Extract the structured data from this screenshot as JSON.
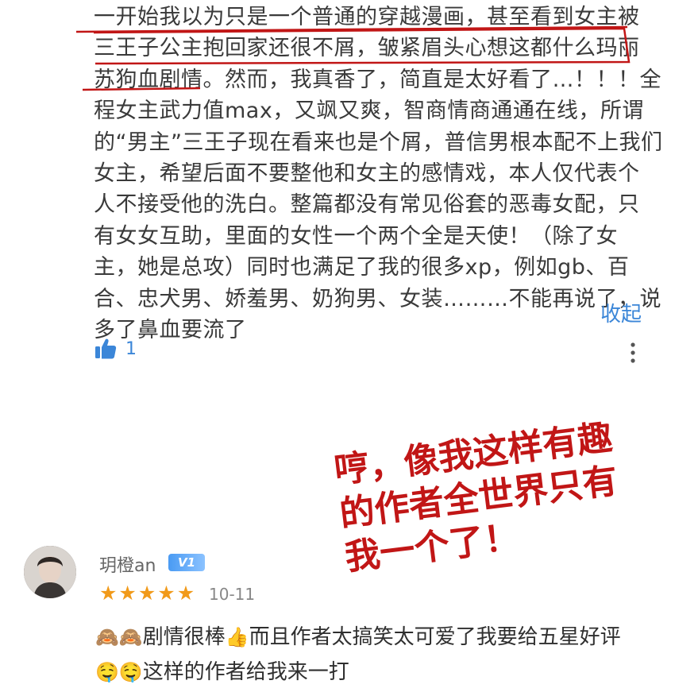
{
  "review": {
    "lines": [
      "一开始我以为只是一个普通的穿越漫画，甚至看到女主被",
      "三王子公主抱回家还很不屑，皱紧眉头心想这都什么玛丽",
      "苏狗血剧情。然而，我真香了，简直是太好看了…！！！全",
      "程女主武力值max，又飒又爽，智商情商通通在线，所谓",
      "的“男主”三王子现在看来也是个屑，普信男根本配不上我们",
      "女主，希望后面不要整他和女主的感情戏，本人仅代表个",
      "人不接受他的洗白。整篇都没有常见俗套的恶毒女配，只",
      "有女女互助，里面的女性一个两个全是天使！（除了女",
      "主，她是总攻）同时也满足了我的很多xp，例如gb、百",
      "合、忠犬男、娇羞男、奶狗男、女装………不能再说了，说",
      "多了鼻血要流了"
    ],
    "collapse_label": "收起",
    "like_count": "1",
    "like_icon": "thumbs-up-icon",
    "more_icon": "more-vertical-icon"
  },
  "annotation": {
    "lines": [
      "哼，像我这样有趣",
      "的作者全世界只有",
      "我一个了！"
    ],
    "color": "#c11616"
  },
  "comment": {
    "username": "玥橙an",
    "badge": "V1",
    "rating": 5,
    "date": "10-11",
    "line1_a": "剧情很棒",
    "line1_b": "而且作者太搞笑太可爱了我要给五星好评",
    "line2": "这样的作者给我来一打"
  },
  "colors": {
    "accent": "#3b86d8",
    "star": "#f19a1a",
    "mark": "#c11616"
  }
}
